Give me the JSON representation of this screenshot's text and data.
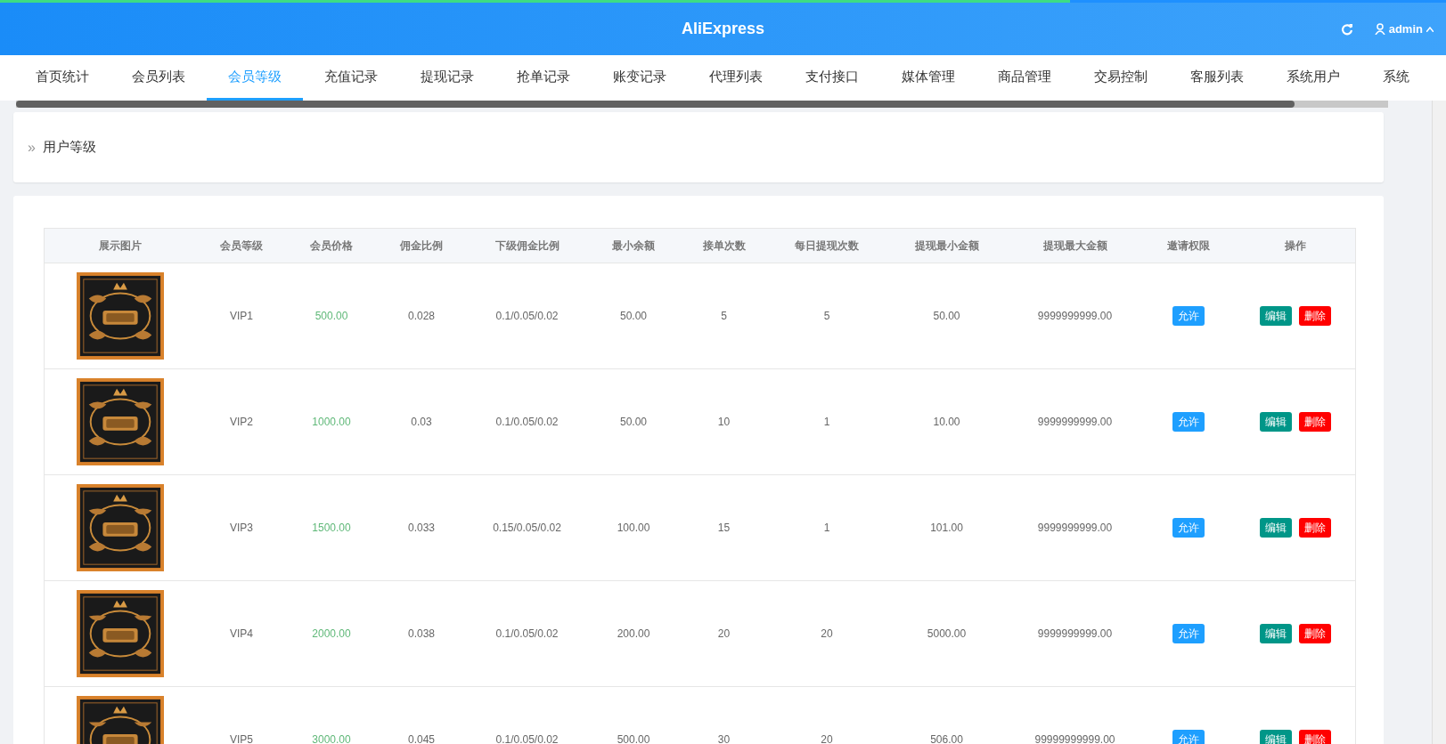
{
  "loading_bar": {
    "level": 0.74
  },
  "header": {
    "title": "AliExpress",
    "user": "admin"
  },
  "tabs": [
    {
      "label": "首页统计",
      "selected": false
    },
    {
      "label": "会员列表",
      "selected": false
    },
    {
      "label": "会员等级",
      "selected": true
    },
    {
      "label": "充值记录",
      "selected": false
    },
    {
      "label": "提现记录",
      "selected": false
    },
    {
      "label": "抢单记录",
      "selected": false
    },
    {
      "label": "账变记录",
      "selected": false
    },
    {
      "label": "代理列表",
      "selected": false
    },
    {
      "label": "支付接口",
      "selected": false
    },
    {
      "label": "媒体管理",
      "selected": false
    },
    {
      "label": "商品管理",
      "selected": false
    },
    {
      "label": "交易控制",
      "selected": false
    },
    {
      "label": "客服列表",
      "selected": false
    },
    {
      "label": "系统用户",
      "selected": false
    },
    {
      "label": "系统",
      "selected": false
    }
  ],
  "breadcrumb": {
    "separator": "»",
    "title": "用户等级"
  },
  "table": {
    "columns": [
      "展示图片",
      "会员等级",
      "会员价格",
      "佣金比例",
      "下级佣金比例",
      "最小余额",
      "接单次数",
      "每日提现次数",
      "提现最小金额",
      "提现最大金额",
      "邀请权限",
      "操作"
    ],
    "rows": [
      {
        "level": "VIP1",
        "price": "500.00",
        "commission": "0.028",
        "sub_commission": "0.1/0.05/0.02",
        "min_balance": "50.00",
        "orders": "5",
        "daily_withdrawals": "5",
        "min_withdraw": "50.00",
        "max_withdraw": "9999999999.00",
        "invite": "允许",
        "actions": [
          "编辑",
          "删除"
        ]
      },
      {
        "level": "VIP2",
        "price": "1000.00",
        "commission": "0.03",
        "sub_commission": "0.1/0.05/0.02",
        "min_balance": "50.00",
        "orders": "10",
        "daily_withdrawals": "1",
        "min_withdraw": "10.00",
        "max_withdraw": "9999999999.00",
        "invite": "允许",
        "actions": [
          "编辑",
          "删除"
        ]
      },
      {
        "level": "VIP3",
        "price": "1500.00",
        "commission": "0.033",
        "sub_commission": "0.15/0.05/0.02",
        "min_balance": "100.00",
        "orders": "15",
        "daily_withdrawals": "1",
        "min_withdraw": "101.00",
        "max_withdraw": "9999999999.00",
        "invite": "允许",
        "actions": [
          "编辑",
          "删除"
        ]
      },
      {
        "level": "VIP4",
        "price": "2000.00",
        "commission": "0.038",
        "sub_commission": "0.1/0.05/0.02",
        "min_balance": "200.00",
        "orders": "20",
        "daily_withdrawals": "20",
        "min_withdraw": "5000.00",
        "max_withdraw": "9999999999.00",
        "invite": "允许",
        "actions": [
          "编辑",
          "删除"
        ]
      },
      {
        "level": "VIP5",
        "price": "3000.00",
        "commission": "0.045",
        "sub_commission": "0.1/0.05/0.02",
        "min_balance": "500.00",
        "orders": "30",
        "daily_withdrawals": "20",
        "min_withdraw": "506.00",
        "max_withdraw": "99999999999.00",
        "invite": "允许",
        "actions": [
          "编辑",
          "删除"
        ]
      }
    ]
  }
}
